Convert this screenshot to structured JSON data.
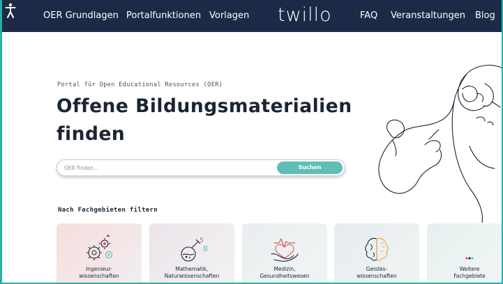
{
  "nav": {
    "left_links": [
      "OER Grundlagen",
      "Portalfunktionen",
      "Vorlagen"
    ],
    "logo": "twillo",
    "right_links": [
      "FAQ",
      "Veranstaltungen",
      "Blog"
    ]
  },
  "hero": {
    "tagline": "Portal für Open Educational Resources (OER)",
    "headline": "Offene Bildungsmaterialien finden"
  },
  "search": {
    "placeholder": "OER finden...",
    "button": "Suchen"
  },
  "filter": {
    "heading": "Nach Fachgebieten filtern",
    "categories": [
      {
        "label": "Ingenieur-\nwissenschaften",
        "icon": "gears-icon"
      },
      {
        "label": "Mathematik,\nNaturwissenschaften",
        "icon": "flask-icon",
        "icon_numbers": [
          "5",
          "8"
        ]
      },
      {
        "label": "Medizin,\nGesundheitswesen",
        "icon": "heartbeat-hands-icon"
      },
      {
        "label": "Geistes-\nwissenschaften",
        "icon": "brain-icon"
      },
      {
        "label": "Weitere\nFachgebiete",
        "icon": "dots-icon"
      }
    ]
  },
  "colors": {
    "nav_background": "#1c2a47",
    "accent": "#5fbfb6",
    "frame": "#27b0a7",
    "icon_red": "#e0555a"
  }
}
